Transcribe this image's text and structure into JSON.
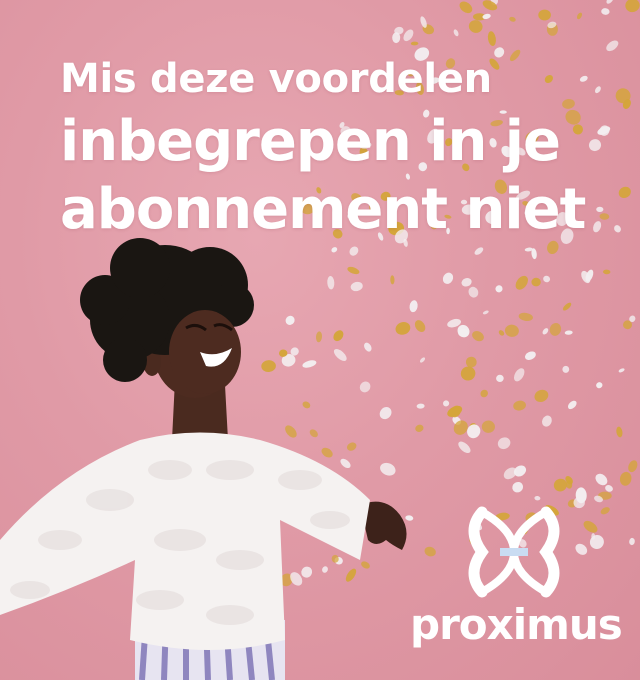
{
  "headline": {
    "line1": "Mis deze voordelen",
    "line2": "inbegrepen in je",
    "line3": "abonnement niet"
  },
  "brand": {
    "name": "proximus",
    "logo_icon": "proximus-logo-icon"
  },
  "colors": {
    "background": "#e09aa6",
    "text": "#ffffff",
    "confetti_gold": "#d4a53a",
    "confetti_white": "#f3eef0",
    "logo_blue": "#c9dcf2"
  }
}
